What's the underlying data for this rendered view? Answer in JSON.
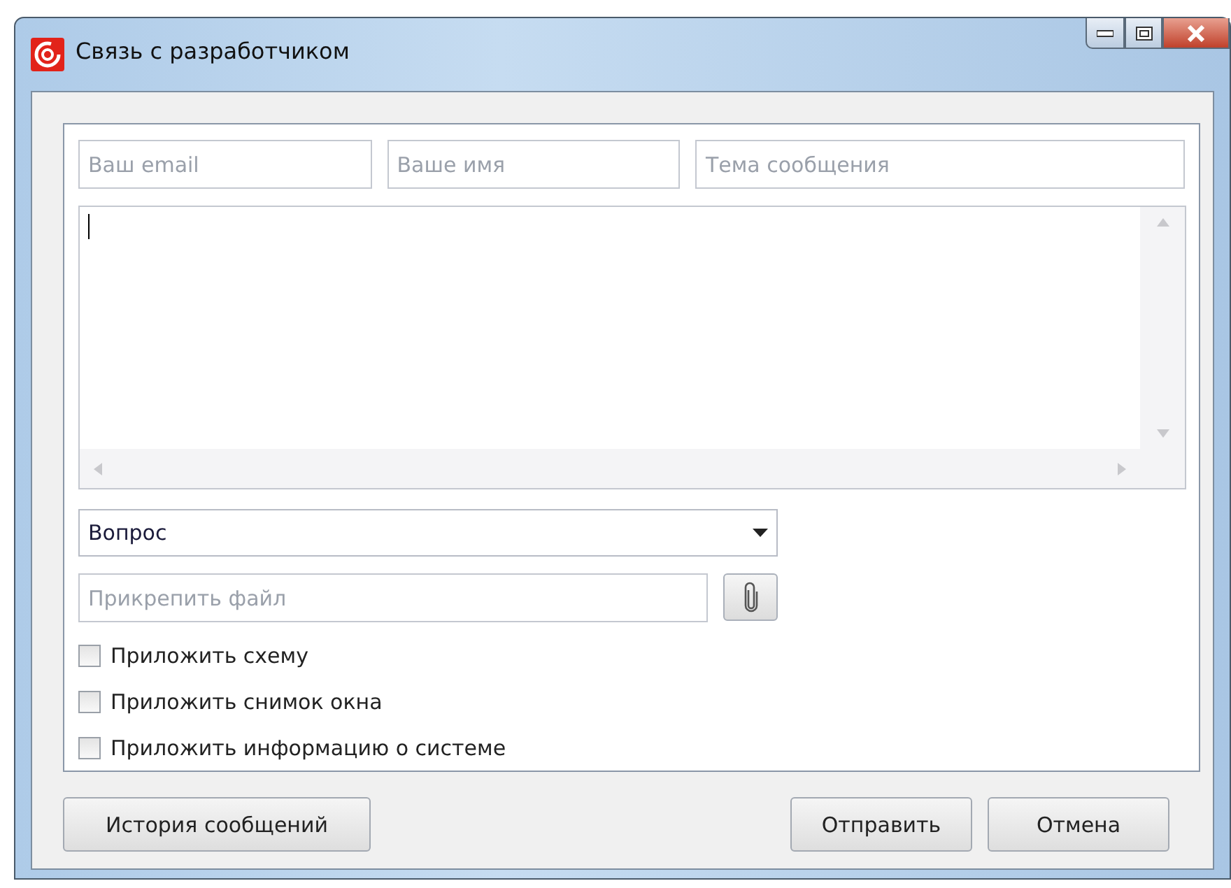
{
  "window": {
    "title": "Связь с разработчиком"
  },
  "fields": [
    {
      "placeholder": "Ваш email"
    },
    {
      "placeholder": "Ваше имя"
    },
    {
      "placeholder": "Тема сообщения"
    }
  ],
  "category": {
    "value": "Вопрос"
  },
  "attachment": {
    "placeholder": "Прикрепить файл"
  },
  "options": [
    {
      "label": "Приложить схему",
      "checked": false
    },
    {
      "label": "Приложить снимок окна",
      "checked": false
    },
    {
      "label": "Приложить информацию о системе",
      "checked": false
    }
  ],
  "buttons": {
    "history": "История сообщений",
    "send": "Отправить",
    "cancel": "Отмена"
  }
}
